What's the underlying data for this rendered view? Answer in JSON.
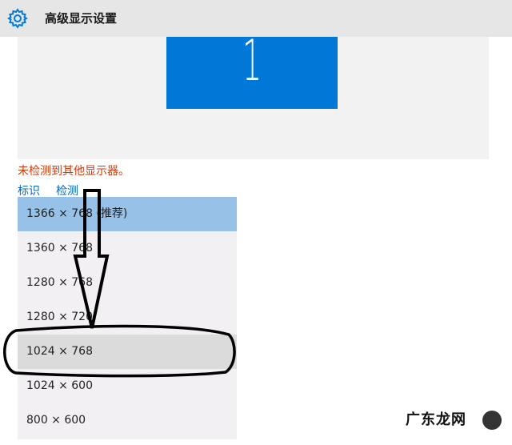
{
  "window": {
    "title": "高级显示设置",
    "icon": "gear-icon"
  },
  "preview": {
    "monitor_label": "1",
    "tile_color": "#0078d7"
  },
  "status": {
    "warning_text": "未检测到其他显示器。",
    "warning_color": "#cf3a0a"
  },
  "links": {
    "identify": "标识",
    "detect": "检测"
  },
  "resolution_dropdown": {
    "selected_index": 0,
    "highlighted_index": 4,
    "options": [
      "1366 × 768 (推荐)",
      "1360 × 768",
      "1280 × 768",
      "1280 × 720",
      "1024 × 768",
      "1024 × 600",
      "800 × 600"
    ]
  },
  "watermark": {
    "text": "广东龙网"
  }
}
